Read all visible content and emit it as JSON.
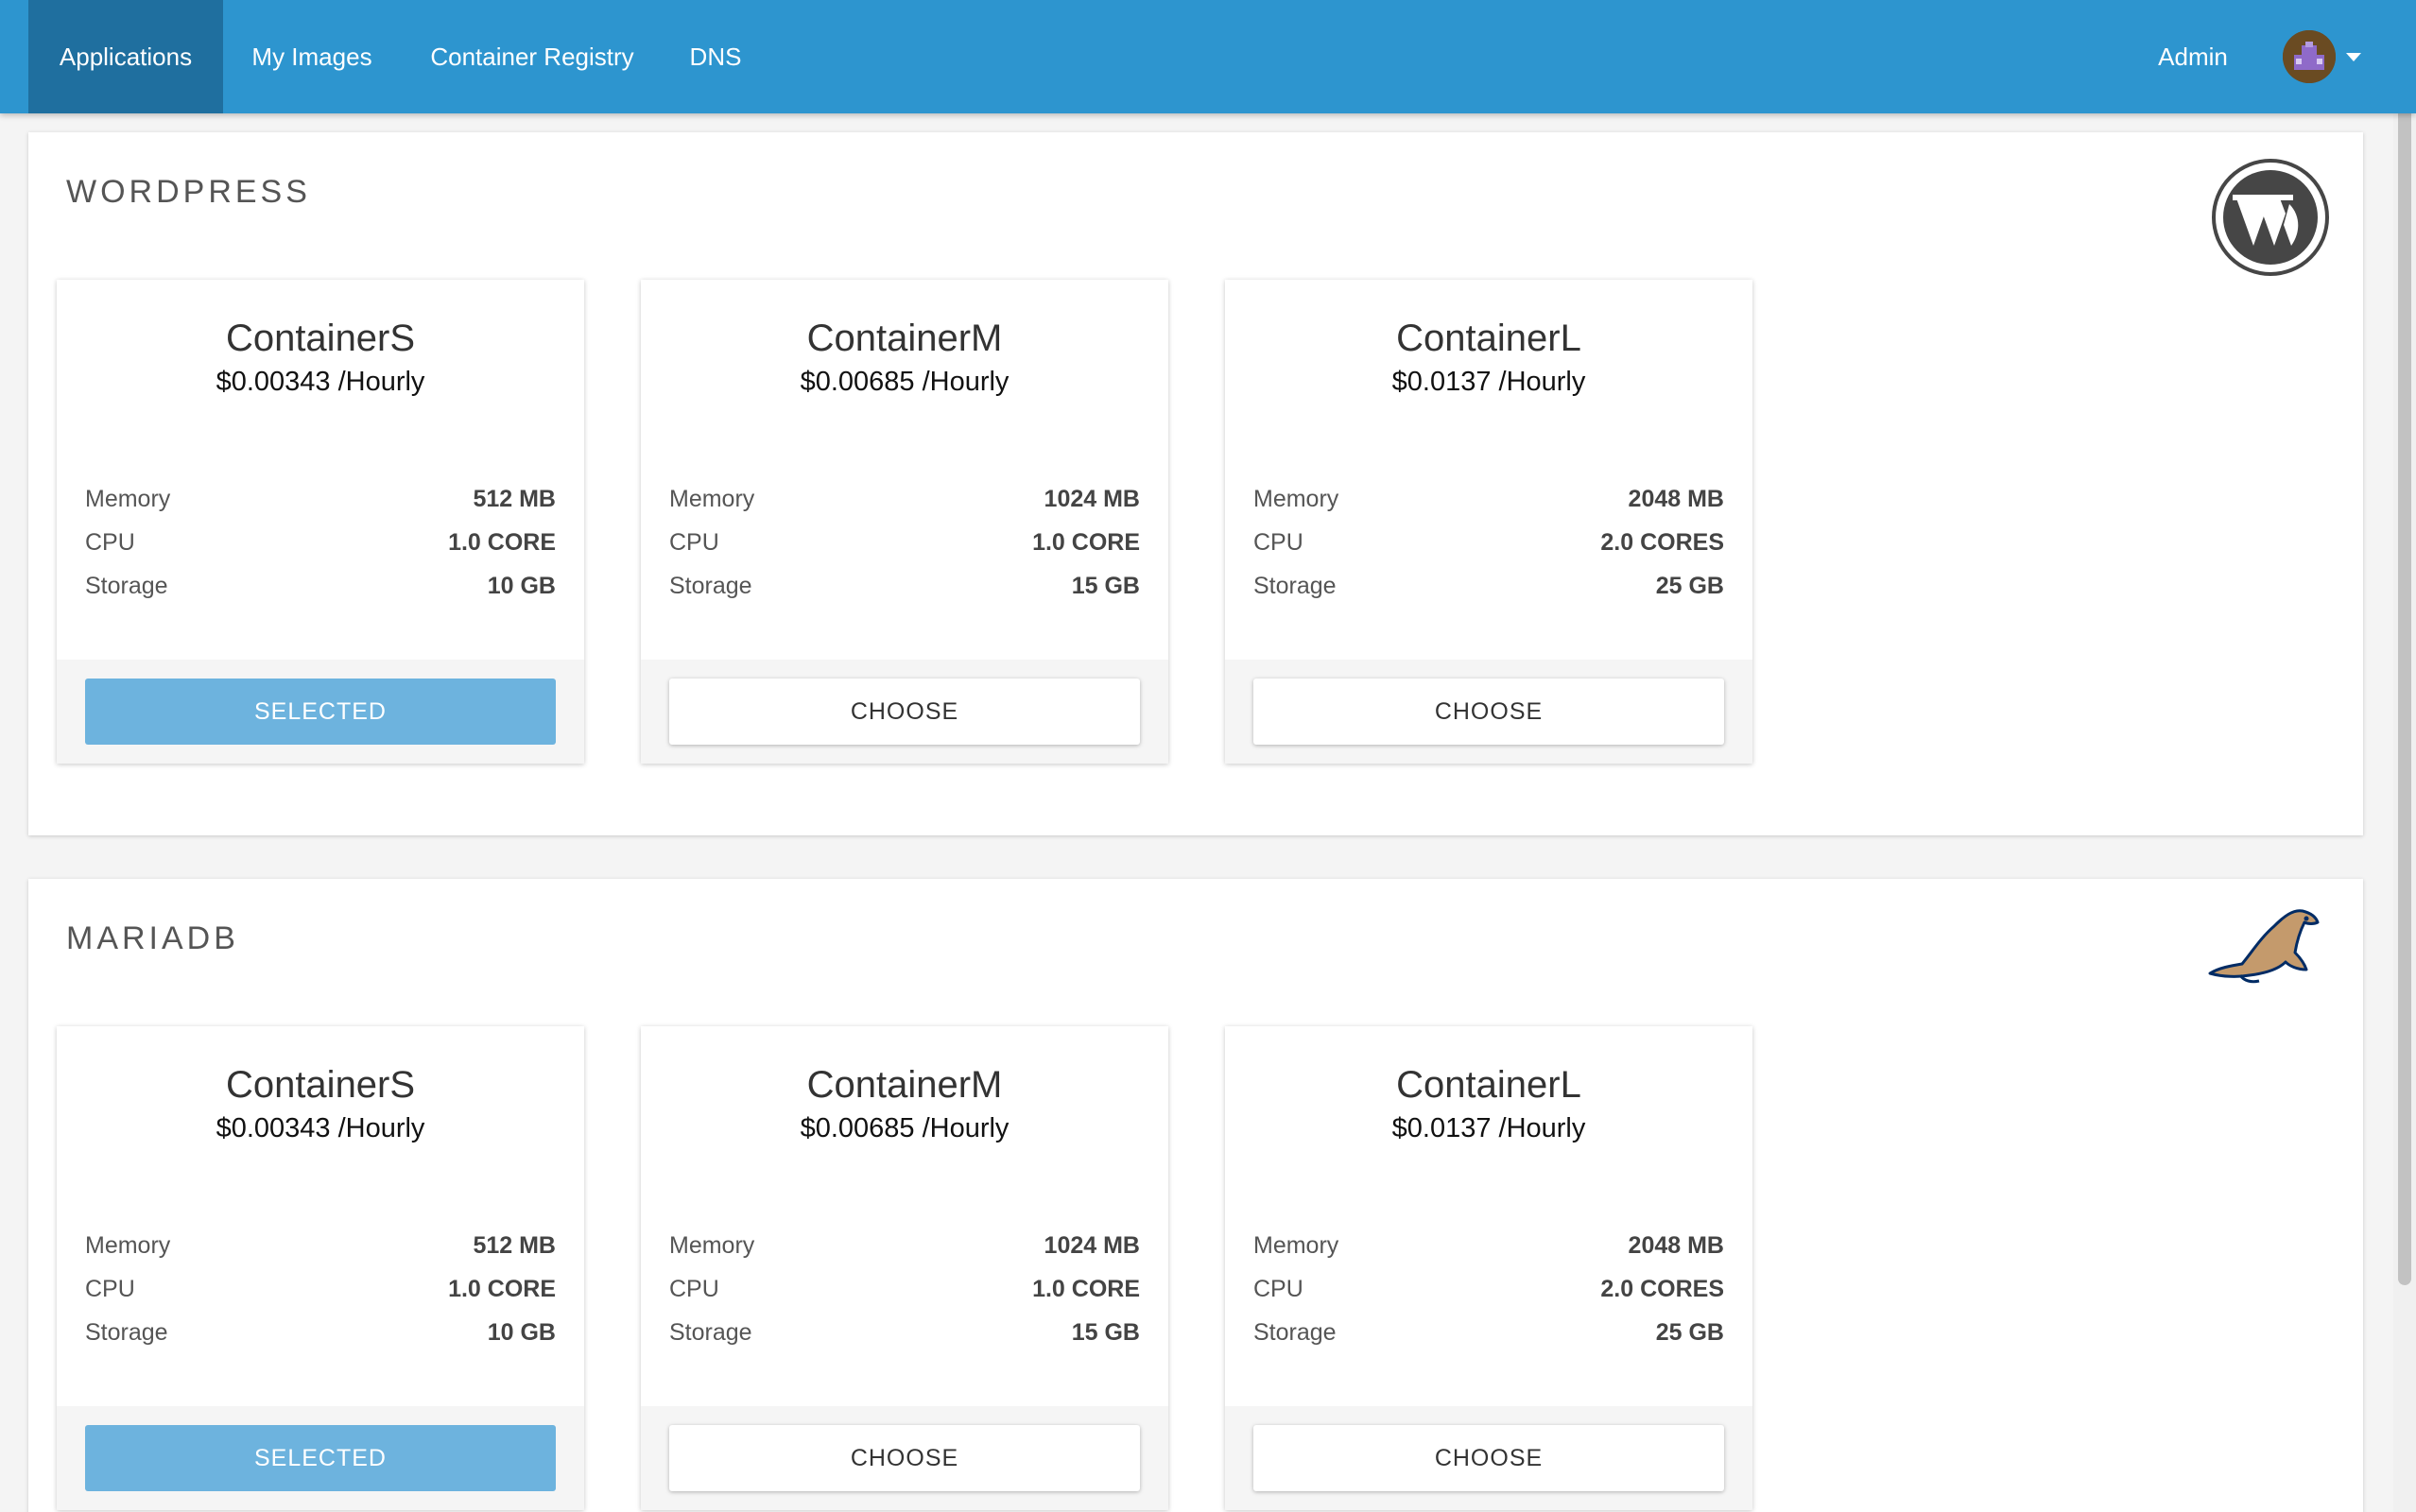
{
  "nav": {
    "tabs": [
      {
        "label": "Applications",
        "active": true
      },
      {
        "label": "My Images",
        "active": false
      },
      {
        "label": "Container Registry",
        "active": false
      },
      {
        "label": "DNS",
        "active": false
      }
    ],
    "user_label": "Admin",
    "avatar_icon": "user-avatar-icon",
    "caret_icon": "caret-down-icon"
  },
  "colors": {
    "nav_bg": "#2d95cf",
    "nav_active": "#1f6f9f",
    "selected_button": "#6db3de"
  },
  "applications": [
    {
      "title": "WORDPRESS",
      "logo_icon": "wordpress-logo-icon",
      "plans": [
        {
          "name": "ContainerS",
          "price": "$0.00343 /Hourly",
          "specs": [
            {
              "label": "Memory",
              "value": "512 MB"
            },
            {
              "label": "CPU",
              "value": "1.0 CORE"
            },
            {
              "label": "Storage",
              "value": "10 GB"
            }
          ],
          "button": "SELECTED",
          "selected": true
        },
        {
          "name": "ContainerM",
          "price": "$0.00685 /Hourly",
          "specs": [
            {
              "label": "Memory",
              "value": "1024 MB"
            },
            {
              "label": "CPU",
              "value": "1.0 CORE"
            },
            {
              "label": "Storage",
              "value": "15 GB"
            }
          ],
          "button": "CHOOSE",
          "selected": false
        },
        {
          "name": "ContainerL",
          "price": "$0.0137 /Hourly",
          "specs": [
            {
              "label": "Memory",
              "value": "2048 MB"
            },
            {
              "label": "CPU",
              "value": "2.0 CORES"
            },
            {
              "label": "Storage",
              "value": "25 GB"
            }
          ],
          "button": "CHOOSE",
          "selected": false
        }
      ]
    },
    {
      "title": "MARIADB",
      "logo_icon": "mariadb-seal-logo-icon",
      "plans": [
        {
          "name": "ContainerS",
          "price": "$0.00343 /Hourly",
          "specs": [
            {
              "label": "Memory",
              "value": "512 MB"
            },
            {
              "label": "CPU",
              "value": "1.0 CORE"
            },
            {
              "label": "Storage",
              "value": "10 GB"
            }
          ],
          "button": "SELECTED",
          "selected": true
        },
        {
          "name": "ContainerM",
          "price": "$0.00685 /Hourly",
          "specs": [
            {
              "label": "Memory",
              "value": "1024 MB"
            },
            {
              "label": "CPU",
              "value": "1.0 CORE"
            },
            {
              "label": "Storage",
              "value": "15 GB"
            }
          ],
          "button": "CHOOSE",
          "selected": false
        },
        {
          "name": "ContainerL",
          "price": "$0.0137 /Hourly",
          "specs": [
            {
              "label": "Memory",
              "value": "2048 MB"
            },
            {
              "label": "CPU",
              "value": "2.0 CORES"
            },
            {
              "label": "Storage",
              "value": "25 GB"
            }
          ],
          "button": "CHOOSE",
          "selected": false
        }
      ]
    }
  ]
}
